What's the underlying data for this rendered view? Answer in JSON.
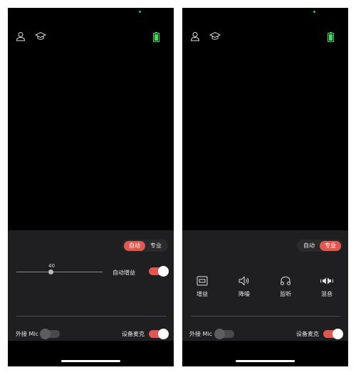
{
  "left_screen": {
    "segment": {
      "auto_label": "自动",
      "pro_label": "专业",
      "selected": "自动"
    },
    "slider": {
      "value": "40"
    },
    "auto_gain": {
      "label": "自动增益",
      "on": true
    },
    "external_mic": {
      "label": "外接 Mic",
      "on": false
    },
    "device_mic": {
      "label": "设备麦克",
      "on": true
    }
  },
  "right_screen": {
    "segment": {
      "auto_label": "自动",
      "pro_label": "专业",
      "selected": "专业"
    },
    "features": [
      {
        "label": "增益",
        "icon": "gain-icon"
      },
      {
        "label": "降噪",
        "icon": "speaker-icon"
      },
      {
        "label": "监听",
        "icon": "headphones-icon"
      },
      {
        "label": "混音",
        "icon": "mix-icon"
      }
    ],
    "external_mic": {
      "label": "外接 Mic",
      "on": false
    },
    "device_mic": {
      "label": "设备麦克",
      "on": true
    }
  },
  "colors": {
    "accent": "#e0574f",
    "panel": "#1f1f22",
    "battery": "#3adf5a"
  }
}
